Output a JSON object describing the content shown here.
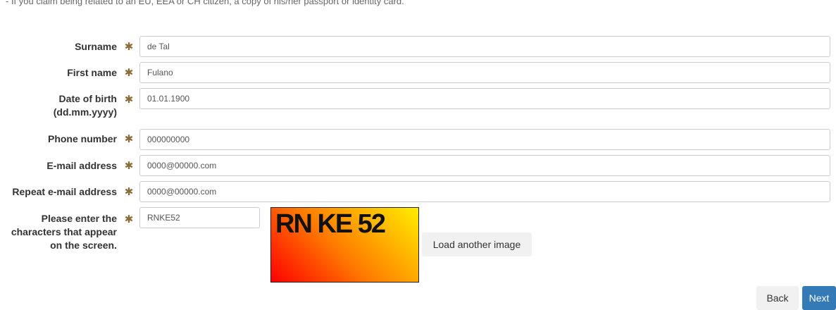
{
  "note": "- If you claim being related to an EU, EEA or CH citizen, a copy of his/her passport or identity card.",
  "required_mark": "✱",
  "fields": {
    "surname": {
      "label": "Surname",
      "value": "de Tal"
    },
    "first_name": {
      "label": "First name",
      "value": "Fulano"
    },
    "dob": {
      "label_line1": "Date of birth",
      "label_line2": "(dd.mm.yyyy)",
      "value": "01.01.1900"
    },
    "phone": {
      "label": "Phone number",
      "value": "000000000"
    },
    "email": {
      "label": "E-mail address",
      "value": "0000@00000.com"
    },
    "repeat_email": {
      "label": "Repeat e-mail address",
      "value": "0000@00000.com"
    },
    "captcha_input": {
      "label_line1": "Please enter the",
      "label_line2": "characters that appear",
      "label_line3": "on the screen.",
      "value": "RNKE52"
    }
  },
  "captcha": {
    "text": "RN KE 52"
  },
  "buttons": {
    "reload": "Load another image",
    "back": "Back",
    "next": "Next"
  },
  "colors": {
    "required_mark": "#8a6d3b",
    "primary_button": "#337ab7"
  }
}
